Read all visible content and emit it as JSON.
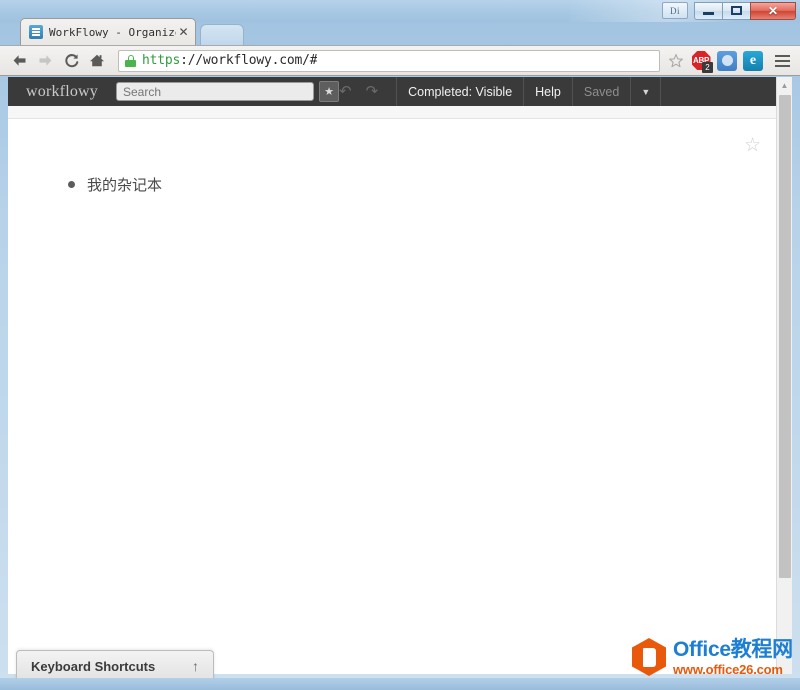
{
  "window": {
    "controls": {
      "di_label": "Di",
      "minimize_name": "minimize",
      "maximize_name": "maximize",
      "close_label": "✕"
    }
  },
  "tab": {
    "title": "WorkFlowy - Organize yo",
    "close_label": "✕",
    "favicon": "workflowy-favicon"
  },
  "browser": {
    "nav": {
      "back": "←",
      "forward": "→",
      "reload": "⟳",
      "home": "⌂"
    },
    "omnibox": {
      "url_scheme": "https",
      "url_rest": "://workflowy.com/#",
      "full_url": "https://workflowy.com/#",
      "lock": "secure-lock-icon",
      "bookmark_star": "☆"
    },
    "extensions": [
      {
        "name": "adblock-plus",
        "label": "ABP",
        "badge": "2"
      },
      {
        "name": "extension-blue-circle",
        "label": ""
      },
      {
        "name": "extension-e",
        "label": "e"
      }
    ],
    "menu": "chrome-menu"
  },
  "app": {
    "logo": "workflowy",
    "search": {
      "value": "",
      "placeholder": "Search"
    },
    "search_star": "★",
    "undo": "↶",
    "redo": "↷",
    "buttons": [
      {
        "name": "completed-visible",
        "label": "Completed: Visible",
        "muted": false
      },
      {
        "name": "help",
        "label": "Help",
        "muted": false
      },
      {
        "name": "saved-status",
        "label": "Saved",
        "muted": true
      }
    ],
    "caret": "▼"
  },
  "page": {
    "star": "☆",
    "outline": [
      {
        "text": "我的杂记本"
      }
    ]
  },
  "scrollbar": {
    "up_arrow": "▲"
  },
  "footer": {
    "keyboard_shortcuts_label": "Keyboard Shortcuts",
    "keyboard_shortcuts_arrow": "↑"
  },
  "watermark": {
    "title_en": "Office",
    "title_cn": "教程网",
    "url": "www.office26.com"
  },
  "colors": {
    "app_bar_bg": "#3a3a3a",
    "secure_green": "#2f9b3f",
    "watermark_blue": "#1d7fd4",
    "watermark_orange": "#e8590c",
    "abp_red": "#d8252a"
  }
}
